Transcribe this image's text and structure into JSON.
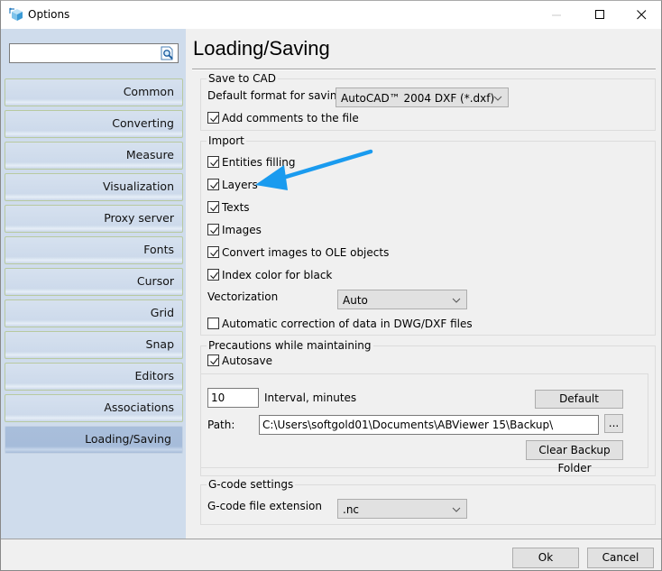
{
  "window": {
    "title": "Options",
    "icon": "cube-icon",
    "controls": {
      "minimize": "minimize-icon",
      "maximize": "maximize-icon",
      "close": "close-icon"
    }
  },
  "sidebar": {
    "search": {
      "value": "",
      "placeholder": "",
      "icon": "search-icon"
    },
    "items": [
      {
        "label": "Common",
        "active": false
      },
      {
        "label": "Converting",
        "active": false
      },
      {
        "label": "Measure",
        "active": false
      },
      {
        "label": "Visualization",
        "active": false
      },
      {
        "label": "Proxy server",
        "active": false
      },
      {
        "label": "Fonts",
        "active": false
      },
      {
        "label": "Cursor",
        "active": false
      },
      {
        "label": "Grid",
        "active": false
      },
      {
        "label": "Snap",
        "active": false
      },
      {
        "label": "Editors",
        "active": false
      },
      {
        "label": "Associations",
        "active": false
      },
      {
        "label": "Loading/Saving",
        "active": true
      }
    ]
  },
  "page": {
    "title": "Loading/Saving",
    "save_to_cad": {
      "legend": "Save to CAD",
      "default_format_label": "Default format for saving",
      "default_format_value": "AutoCAD™ 2004 DXF (*.dxf)",
      "add_comments": {
        "label": "Add comments to the file",
        "checked": true
      }
    },
    "import": {
      "legend": "Import",
      "options": [
        {
          "label": "Entities filling",
          "checked": true
        },
        {
          "label": "Layers",
          "checked": true
        },
        {
          "label": "Texts",
          "checked": true
        },
        {
          "label": "Images",
          "checked": true
        },
        {
          "label": "Convert images to OLE objects",
          "checked": true
        },
        {
          "label": "Index color for black",
          "checked": true
        }
      ],
      "vectorization_label": "Vectorization",
      "vectorization_value": "Auto",
      "auto_correction": {
        "label": "Automatic correction of data in DWG/DXF files",
        "checked": false
      }
    },
    "precautions": {
      "legend": "Precautions while maintaining",
      "autosave": {
        "label": "Autosave",
        "checked": true
      },
      "interval_value": "10",
      "interval_label": "Interval, minutes",
      "default_button": "Default",
      "path_label": "Path:",
      "path_value": "C:\\Users\\softgold01\\Documents\\ABViewer 15\\Backup\\",
      "browse_button": "...",
      "clear_button": "Clear Backup Folder"
    },
    "gcode": {
      "legend": "G-code settings",
      "extension_label": "G-code file extension",
      "extension_value": ".nc"
    }
  },
  "footer": {
    "ok": "Ok",
    "cancel": "Cancel"
  },
  "annotation": {
    "type": "arrow",
    "color": "#1a9bef",
    "points_to": "Layers"
  }
}
